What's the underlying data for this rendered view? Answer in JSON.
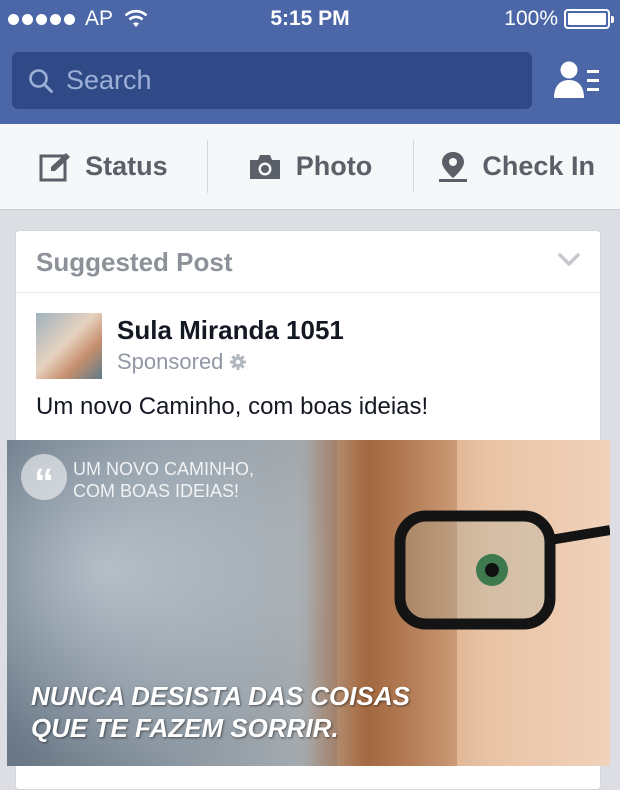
{
  "status_bar": {
    "carrier": "AP",
    "time": "5:15 PM",
    "battery": "100%"
  },
  "search": {
    "placeholder": "Search"
  },
  "composer": {
    "status": "Status",
    "photo": "Photo",
    "checkin": "Check In"
  },
  "card": {
    "header": "Suggested Post",
    "page_name": "Sula Miranda 1051",
    "sponsored": "Sponsored",
    "text": "Um novo Caminho, com boas ideias!",
    "image": {
      "tag_line1": "UM NOVO CAMINHO,",
      "tag_line2": "COM BOAS IDEIAS!",
      "slogan_line1": "NUNCA DESISTA DAS COISAS",
      "slogan_line2": "QUE TE FAZEM SORRIR."
    }
  },
  "colors": {
    "brand_blue": "#4b67a8",
    "search_bg": "#2f4a86"
  }
}
